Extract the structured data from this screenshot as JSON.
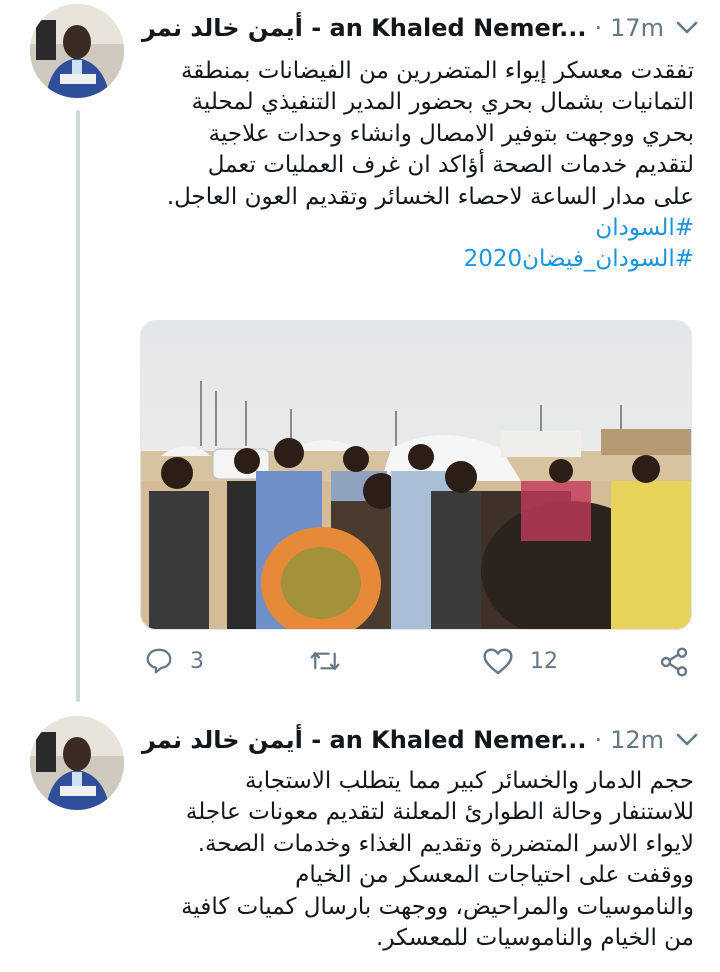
{
  "tweets": [
    {
      "display_name": "أيمن خالد نمر - an Khaled Nemer...",
      "separator": "·",
      "timestamp": "17m",
      "body_lines": [
        "تفقدت معسكر إيواء المتضررين من الفيضانات بمنطقة",
        "التمانيات بشمال بحري بحضور المدير التنفيذي لمحلية",
        "بحري ووجهت  بتوفير الامصال وانشاء وحدات علاجية",
        "لتقديم خدمات الصحة أؤاكد  ان غرف العمليات تعمل",
        "على مدار الساعة لاحصاء الخسائر وتقديم العون العاجل."
      ],
      "hashtags": [
        "#السودان",
        "#السودان_فيضان2020"
      ],
      "replies": "3",
      "retweets": "",
      "likes": "12"
    },
    {
      "display_name": "أيمن خالد نمر - an Khaled Nemer...",
      "separator": "·",
      "timestamp": "12m",
      "body_lines": [
        "حجم الدمار والخسائر كبير مما يتطلب الاستجابة",
        "للاستنفار وحالة الطوارئ المعلنة لتقديم معونات عاجلة",
        "لايواء الاسر المتضررة وتقديم الغذاء وخدمات الصحة.",
        "ووقفت  على احتياجات المعسكر من الخيام",
        "والناموسيات والمراحيض، ووجهت  بارسال كميات كافية",
        "من الخيام والناموسيات للمعسكر."
      ]
    }
  ],
  "colors": {
    "hashtag": "#1b95e0",
    "muted": "#657786",
    "thread_line": "#ccd6dd",
    "text": "#14171a"
  },
  "icons": [
    "chevron-down-icon",
    "reply-icon",
    "retweet-icon",
    "like-icon",
    "share-icon"
  ]
}
